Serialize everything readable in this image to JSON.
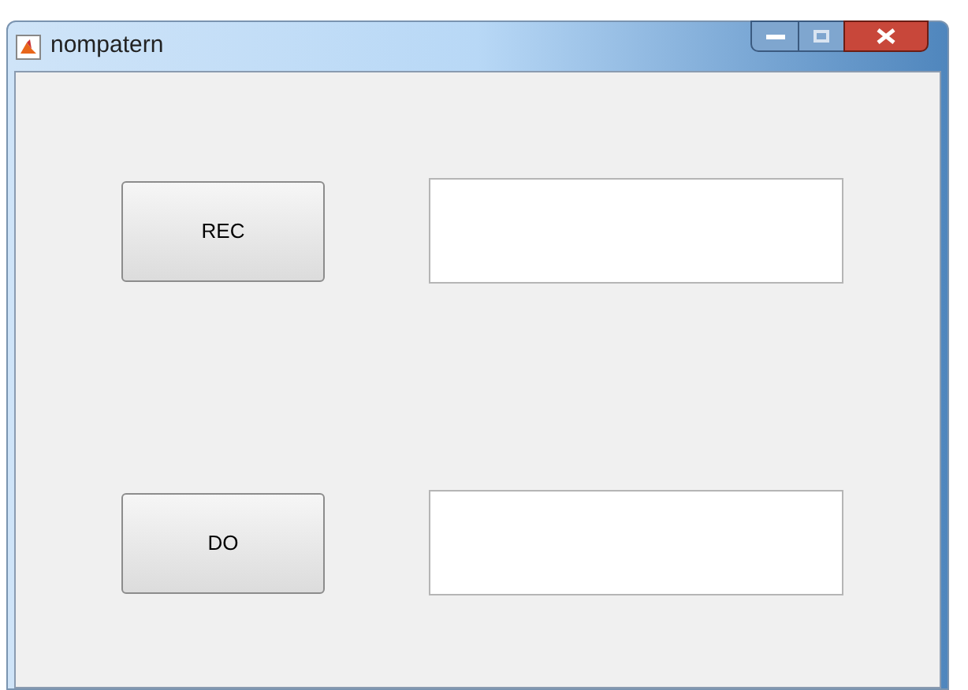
{
  "window": {
    "title": "nompatern"
  },
  "rows": [
    {
      "button": "REC"
    },
    {
      "button": "DO"
    }
  ]
}
